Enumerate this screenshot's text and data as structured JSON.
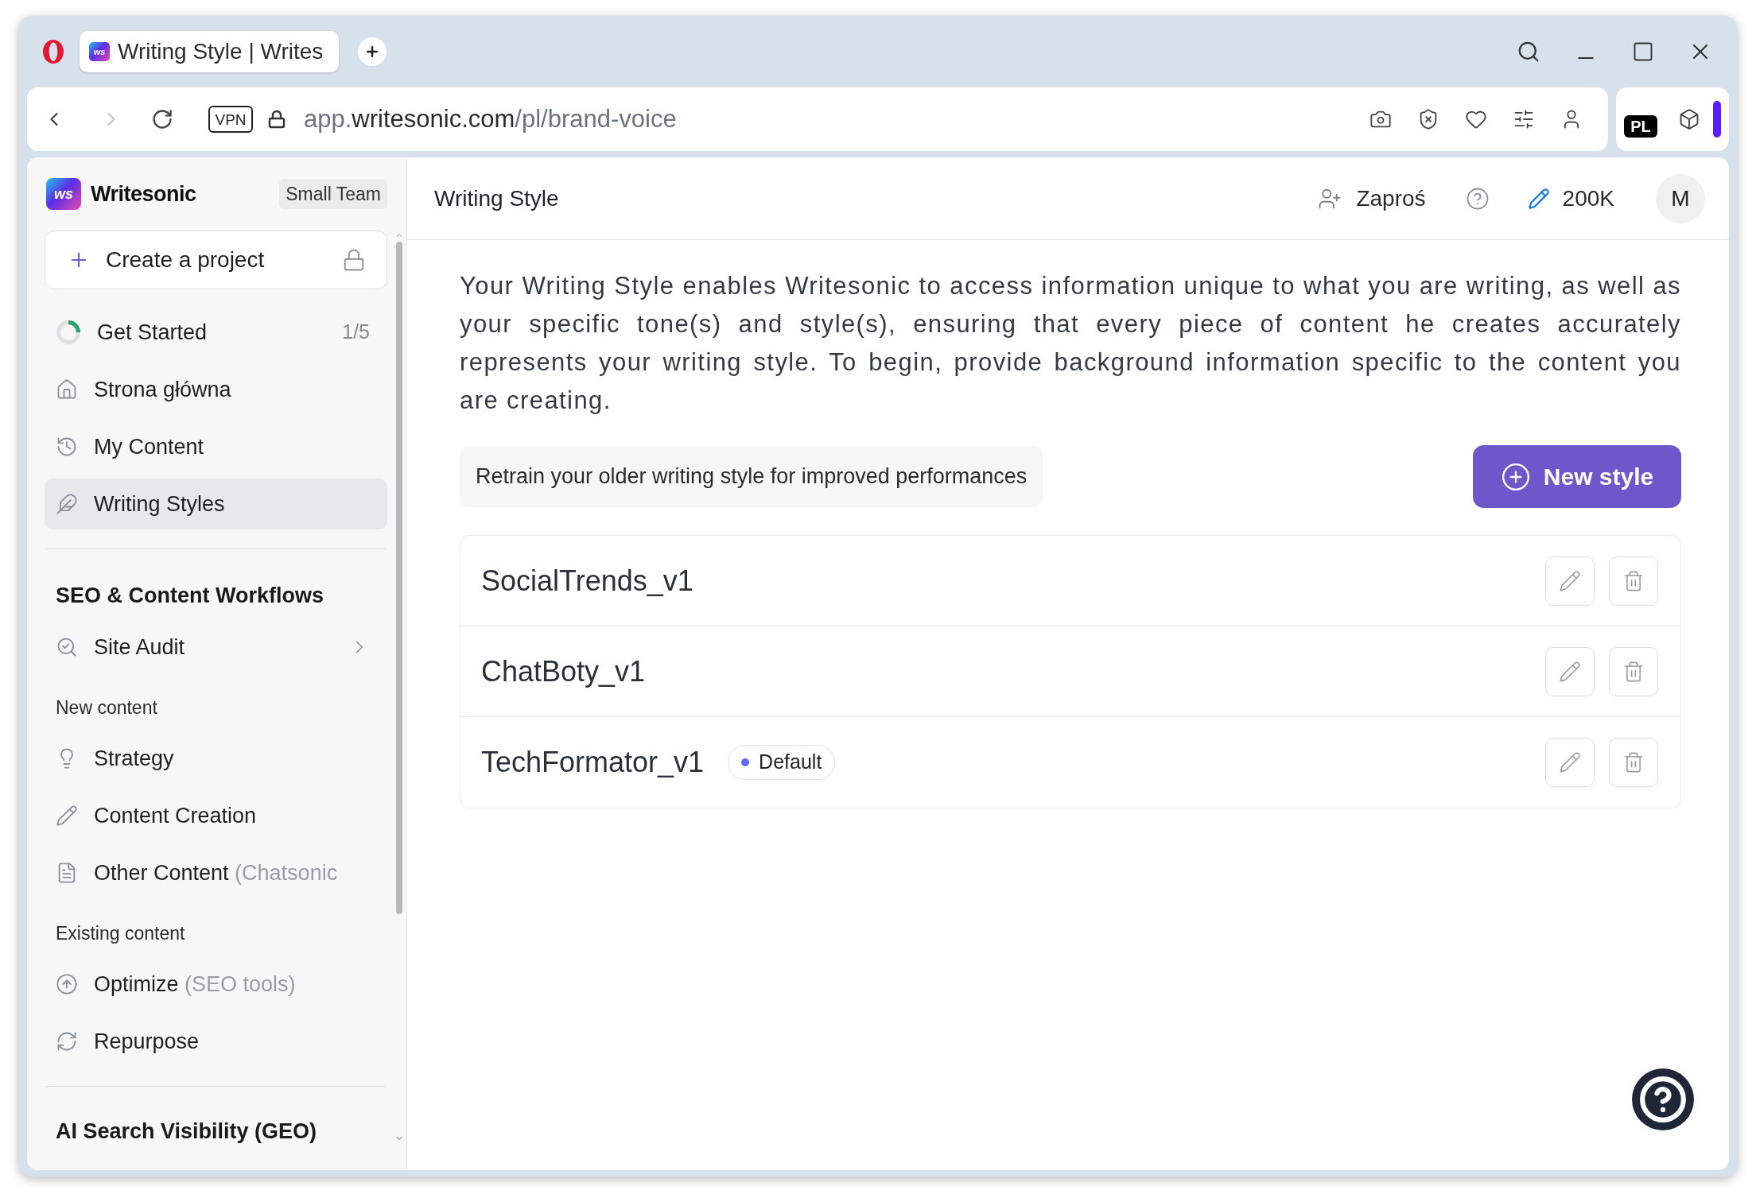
{
  "browser": {
    "tab": {
      "favicon_text": "ws",
      "title": "Writing Style | Writes"
    },
    "navigation": {
      "forward_disabled": true
    },
    "address_bar": {
      "vpn_label": "VPN",
      "url": {
        "subdomain": "app.",
        "domain": "writesonic.com",
        "path": "/pl/brand-voice"
      }
    },
    "extensions": {
      "language_badge": "PL"
    }
  },
  "sidebar": {
    "logo_text": "ws",
    "brand_name": "Writesonic",
    "plan_badge": "Small Team",
    "create_project": {
      "label": "Create a project",
      "locked": true
    },
    "top_items": [
      {
        "kind": "progress",
        "label": "Get Started",
        "count": "1/5",
        "level": 0.25,
        "selected": false
      },
      {
        "kind": "link",
        "label": "Strona główna",
        "selected": false
      },
      {
        "kind": "link",
        "label": "My Content",
        "selected": false
      },
      {
        "kind": "link",
        "label": "Writing Styles",
        "selected": true
      }
    ],
    "sections": [
      {
        "title": "SEO & Content Workflows",
        "groups": [
          {
            "items": [
              {
                "label": "Site Audit",
                "has_submenu": true,
                "selected": false
              }
            ]
          },
          {
            "heading": "New content",
            "items": [
              {
                "label": "Strategy",
                "has_submenu": false,
                "selected": false
              },
              {
                "label": "Content Creation",
                "has_submenu": false,
                "selected": false
              },
              {
                "label": "Other Content",
                "note": "(Chatsonic",
                "has_submenu": false,
                "selected": false
              }
            ]
          },
          {
            "heading": "Existing content",
            "items": [
              {
                "label": "Optimize",
                "note": "(SEO tools)",
                "has_submenu": false,
                "selected": false
              },
              {
                "label": "Repurpose",
                "has_submenu": false,
                "selected": false
              }
            ]
          }
        ]
      },
      {
        "title": "AI Search Visibility (GEO)"
      }
    ]
  },
  "main": {
    "header": {
      "title": "Writing Style",
      "invite_label": "Zaproś",
      "credits": "200K",
      "avatar_initial": "M"
    },
    "description": "Your Writing Style enables Writesonic to access information unique to what you are writing, as well as your specific tone(s) and style(s), ensuring that every piece of content he creates accurately represents your writing style. To begin, provide background information specific to the content you are creating.",
    "retrain_notice": "Retrain your older writing style for improved performances",
    "new_style_label": "New style",
    "styles": [
      {
        "name": "SocialTrends_v1"
      },
      {
        "name": "ChatBoty_v1"
      },
      {
        "name": "TechFormator_v1",
        "badge": "Default"
      }
    ]
  }
}
